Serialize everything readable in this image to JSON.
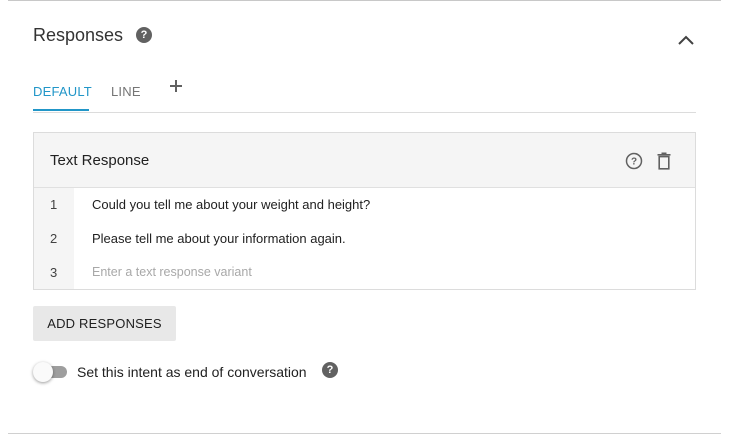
{
  "section": {
    "title": "Responses",
    "help_icon": "question-circle-icon",
    "collapse_icon": "chevron-up-icon"
  },
  "tabs": [
    {
      "label": "DEFAULT",
      "active": true
    },
    {
      "label": "LINE",
      "active": false
    }
  ],
  "tab_add_icon": "plus-icon",
  "card": {
    "title": "Text Response",
    "help_icon": "question-circle-outline-icon",
    "delete_icon": "trash-icon",
    "rows": [
      {
        "num": "1",
        "text": "Could you tell me about your weight and height?"
      },
      {
        "num": "2",
        "text": "Please tell me about your information again."
      },
      {
        "num": "3",
        "text": "",
        "placeholder": "Enter a text response variant"
      }
    ]
  },
  "add_button_label": "ADD RESPONSES",
  "end_conversation": {
    "label": "Set this intent as end of conversation",
    "enabled": false,
    "help_icon": "question-circle-icon"
  },
  "colors": {
    "accent": "#2196c8",
    "help_icon": "#616161",
    "button_bg": "#e8e8e8",
    "card_header_bg": "#f5f5f5"
  }
}
